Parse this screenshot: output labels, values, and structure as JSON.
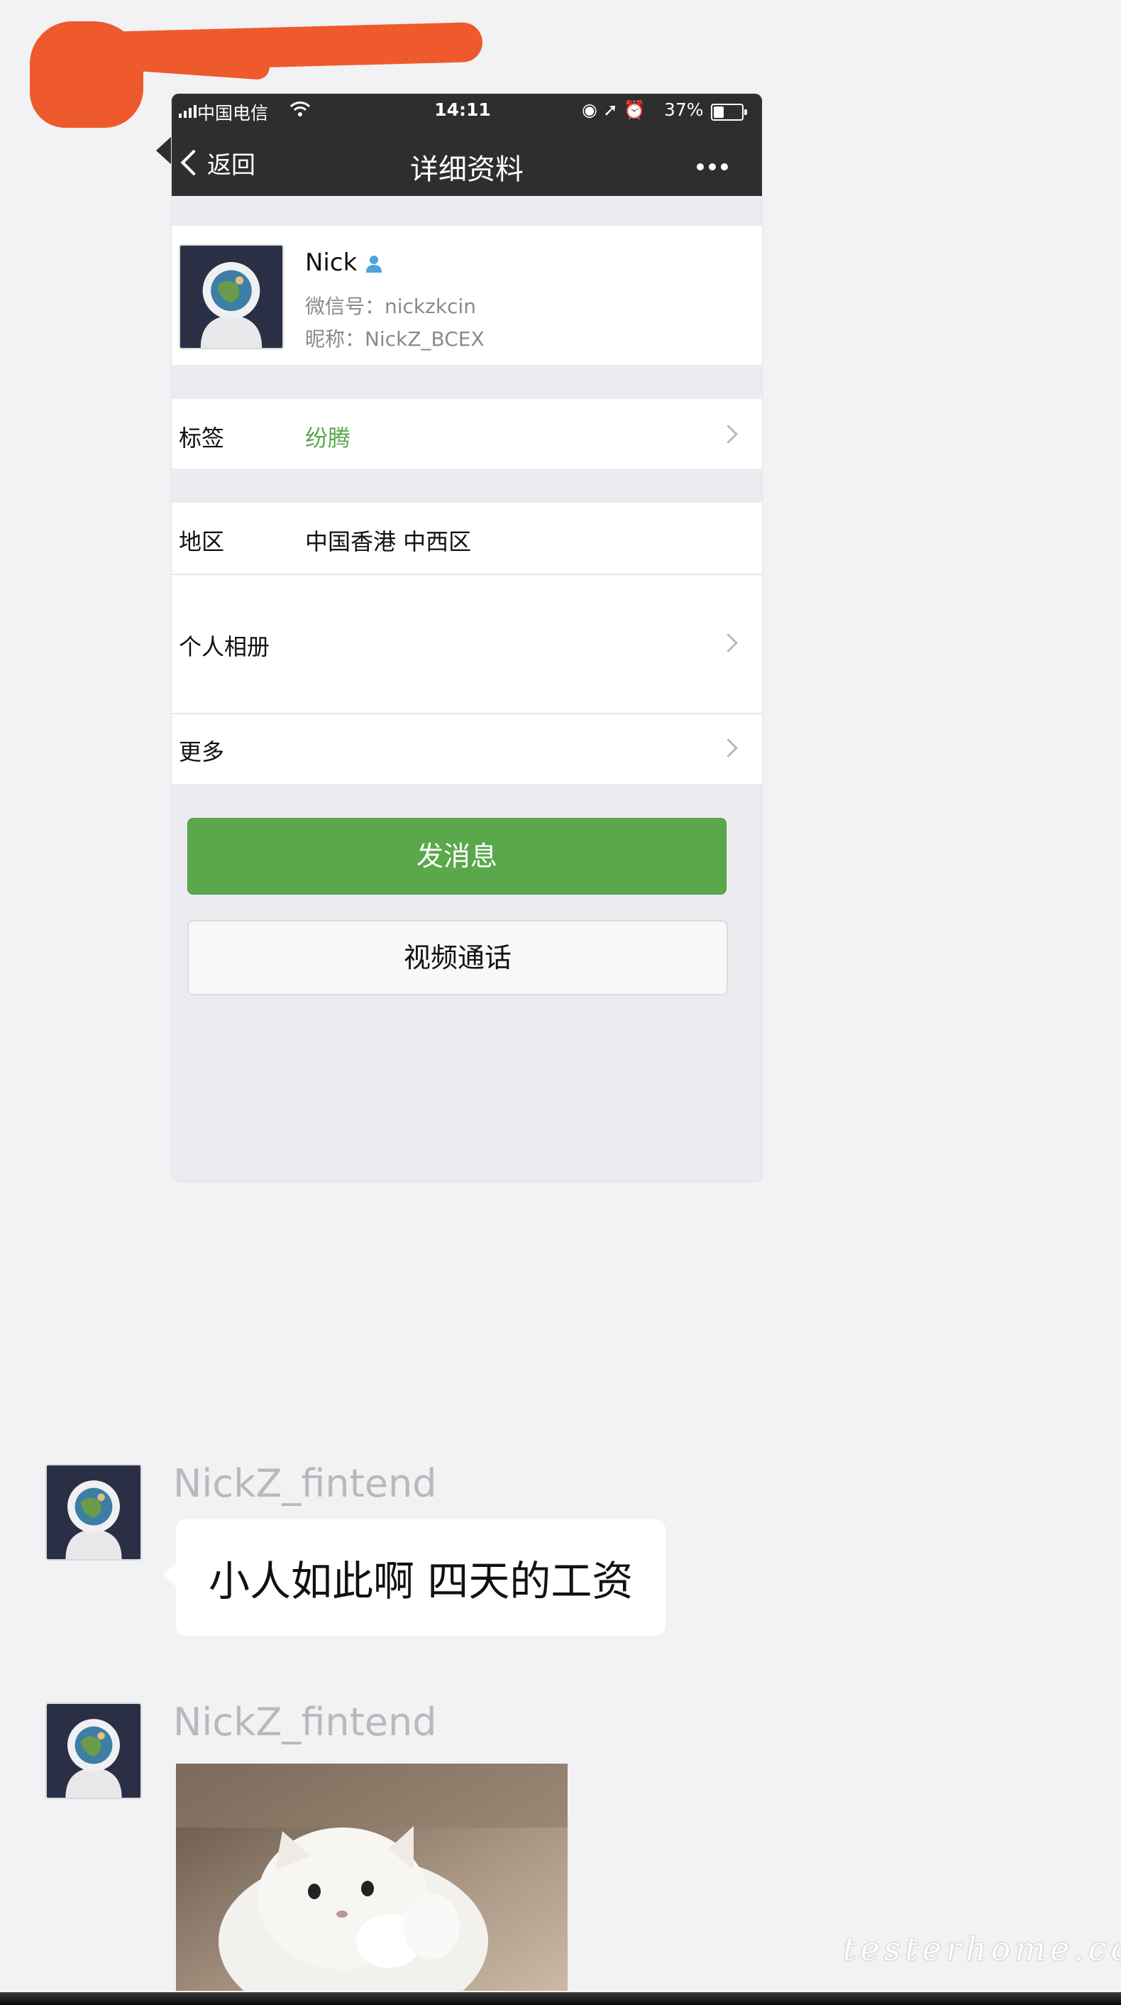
{
  "status_bar": {
    "carrier": "中国电信",
    "time": "14:11",
    "battery": "37%"
  },
  "nav": {
    "back_label": "返回",
    "title": "详细资料"
  },
  "profile": {
    "name": "Nick",
    "wechat_id": "微信号：nickzkcin",
    "nickname": "昵称：NickZ_BCEX"
  },
  "rows": {
    "tag_key": "标签",
    "tag_value": "纷腾",
    "region_key": "地区",
    "region_value": "中国香港 中西区",
    "album_key": "个人相册",
    "more_key": "更多"
  },
  "buttons": {
    "send_message": "发消息",
    "video_call": "视频通话"
  },
  "chat": {
    "messages": [
      {
        "sender": "NickZ_fintend",
        "text": "小人如此啊 四天的工资"
      },
      {
        "sender": "NickZ_fintend"
      }
    ]
  },
  "watermark": "testerhome.com",
  "colors": {
    "nav_bg": "#2e2e2e",
    "accent_green": "#5aa84b",
    "tag_green": "#5aa84b",
    "redaction": "#ee5a2c"
  }
}
